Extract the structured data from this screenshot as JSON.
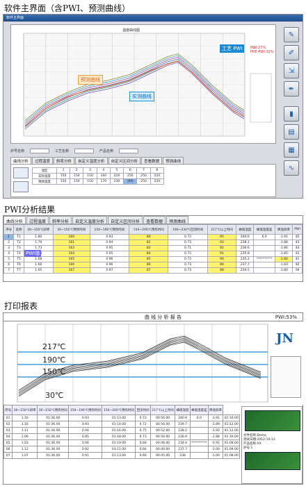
{
  "sections": {
    "main_title": "软件主界面（含PWI、预测曲线）",
    "pwi_title": "PWI分析结果",
    "report_title": "打印报表"
  },
  "main_ui": {
    "window_title": "软件主界面",
    "chart_title": "温度曲线图",
    "labels": {
      "predict": "预测曲线",
      "actual": "实测曲线",
      "process_pwi": "工艺 PWI"
    },
    "pwi_readout": [
      "PWI:27%",
      "PRE-PWI:32%"
    ],
    "controls": [
      "炉号名称",
      "工艺名称",
      "产品名称"
    ],
    "tabs": [
      "曲线分析",
      "过程温度",
      "斜率分析",
      "自定义温度分析",
      "自定义区间分析",
      "查看数据",
      "预测曲线"
    ],
    "table_rows": [
      [
        "温区",
        "1",
        "2",
        "3",
        "4",
        "5",
        "6",
        "7",
        "8"
      ],
      [
        "实际温度",
        "150",
        "150",
        "150",
        "160",
        "220",
        "250",
        "250",
        "250"
      ],
      [
        "预测温度",
        "150",
        "150",
        "150",
        "170",
        "230",
        "260",
        "250",
        "250"
      ]
    ]
  },
  "pwi_panel": {
    "tabs": [
      "曲线分析",
      "过程温度",
      "斜率分析",
      "自定义温度分析",
      "自定义区间分析",
      "查看数据",
      "预测曲线"
    ],
    "headers": [
      "序号",
      "名称",
      "30~150℃斜率",
      "30~150℃预热时间",
      "150~190℃预热时间",
      "150~200℃预热时间",
      "190~230℃回流时间",
      "217℃以上时间",
      "峰值温度",
      "峰值温度差",
      "降温斜率",
      "PWI"
    ],
    "rows": [
      [
        "1",
        "T1",
        "1.80",
        "160",
        "0.93",
        "80",
        "0.72",
        "95",
        "240.6",
        "6.0",
        "-1.91",
        "45"
      ],
      [
        "2",
        "T2",
        "1.79",
        "161",
        "0.94",
        "82",
        "0.73",
        "93",
        "238.1",
        "",
        "-1.88",
        "43"
      ],
      [
        "3",
        "T3",
        "1.73",
        "163",
        "0.95",
        "83",
        "0.71",
        "92",
        "236.6",
        "",
        "-1.86",
        "44"
      ],
      [
        "4",
        "T4",
        "1.70",
        "164",
        "0.95",
        "84",
        "0.72",
        "91",
        "235.8",
        "",
        "-1.85",
        "42"
      ],
      [
        "5",
        "T5",
        "1.68",
        "165",
        "0.96",
        "85",
        "0.72",
        "90",
        "235.2",
        "**********",
        "-1.84",
        "41"
      ],
      [
        "6",
        "T6",
        "1.66",
        "166",
        "0.96",
        "86",
        "0.73",
        "89",
        "237.7",
        "",
        "-1.83",
        "40"
      ],
      [
        "7",
        "T7",
        "1.65",
        "167",
        "0.97",
        "87",
        "0.73",
        "88",
        "234.5",
        "",
        "-1.80",
        "39"
      ]
    ],
    "pwi_label": "PWI值"
  },
  "report": {
    "title": "曲 线 分 析 报 告",
    "pwi": "PWI:53%",
    "logo": "JN",
    "temp_lines": [
      "217℃",
      "190℃",
      "150℃",
      "30℃"
    ],
    "table_header": [
      "序号",
      "30~150℃斜率",
      "30~150℃预热时间",
      "150~190℃预热时间",
      "150~200℃预热时间",
      "回流时间",
      "217℃以上时间",
      "峰值温度",
      "峰值温度差",
      "降温斜率"
    ],
    "table_rows": [
      [
        "01",
        "1.16",
        "01:36.00",
        "0.93",
        "01:13.00",
        "0.72",
        "00:56.00",
        "240.6",
        "6.0",
        "-1.91",
        "01:10.00"
      ],
      [
        "02",
        "1.16",
        "01:36.00",
        "0.93",
        "01:14.00",
        "0.72",
        "00:56.00",
        "239.7",
        "",
        "-1.89",
        "01:12.00"
      ],
      [
        "03",
        "1.11",
        "01:36.00",
        "0.94",
        "01:16.00",
        "0.75",
        "00:52.00",
        "238.2",
        "",
        "-1.92",
        "01:12.00"
      ],
      [
        "04",
        "1.06",
        "01:36.00",
        "0.95",
        "01:18.00",
        "0.73",
        "00:50.00",
        "236.9",
        "",
        "-1.88",
        "01:10.00"
      ],
      [
        "05",
        "1.03",
        "01:36.00",
        "0.94",
        "01:19.00",
        "0.68",
        "00:48.00",
        "234.6",
        "**********",
        "-0.95",
        "01:08.00"
      ],
      [
        "06",
        "1.12",
        "01:36.00",
        "0.92",
        "01:11.00",
        "0.66",
        "00:40.00",
        "237.7",
        "",
        "-1.00",
        "01:09.00"
      ],
      [
        "07",
        "1.07",
        "01:36.00",
        "0.91",
        "01:13.00",
        "0.66",
        "00:45.00",
        "238",
        "",
        "-1.00",
        "01:08.00"
      ]
    ],
    "side_info": [
      "文件名称:Demo",
      "测试日期:2012-10-13",
      "产品名称:XX",
      "炉号:1"
    ]
  },
  "colors": {
    "accent": "#1c5fa8",
    "predict_label": "#e8a040",
    "actual_label": "#1a8ad4",
    "yellow_cell": "#fff46a",
    "blue_cell": "#8fb8ea",
    "report_logo": "#1c5fa8"
  }
}
